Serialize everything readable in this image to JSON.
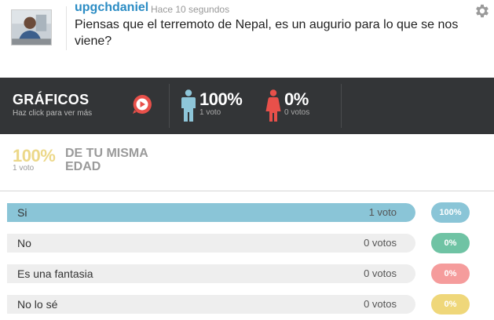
{
  "post": {
    "username": "upgchdaniel",
    "timestamp": "Hace 10 segundos",
    "question": "Piensas que el terremoto de Nepal, es un augurio para lo que se nos viene?"
  },
  "stats": {
    "title": "GRÁFICOS",
    "subtitle": "Haz click para ver más",
    "male": {
      "percent": "100%",
      "votes": "1 voto",
      "color": "#8ec6d9"
    },
    "female": {
      "percent": "0%",
      "votes": "0 votos",
      "color": "#e8504a"
    }
  },
  "age": {
    "percent": "100%",
    "votes": "1 voto",
    "label": "DE TU MISMA EDAD"
  },
  "options": [
    {
      "label": "Si",
      "votes": "1 voto",
      "percent": "100%",
      "fraction": 1.0,
      "fill_color": "#8ac5d7",
      "pill_color": "#8ac5d7"
    },
    {
      "label": "No",
      "votes": "0 votos",
      "percent": "0%",
      "fraction": 0.0,
      "fill_color": "#6fc3a4",
      "pill_color": "#6fc3a4"
    },
    {
      "label": "Es una fantasia",
      "votes": "0 votos",
      "percent": "0%",
      "fraction": 0.0,
      "fill_color": "#f59c9c",
      "pill_color": "#f59c9c"
    },
    {
      "label": "No lo sé",
      "votes": "0 votos",
      "percent": "0%",
      "fraction": 0.0,
      "fill_color": "#efd77a",
      "pill_color": "#efd77a"
    }
  ],
  "icons": {
    "settings": "gear-icon",
    "play": "play-icon",
    "male": "male-icon",
    "female": "female-icon"
  }
}
